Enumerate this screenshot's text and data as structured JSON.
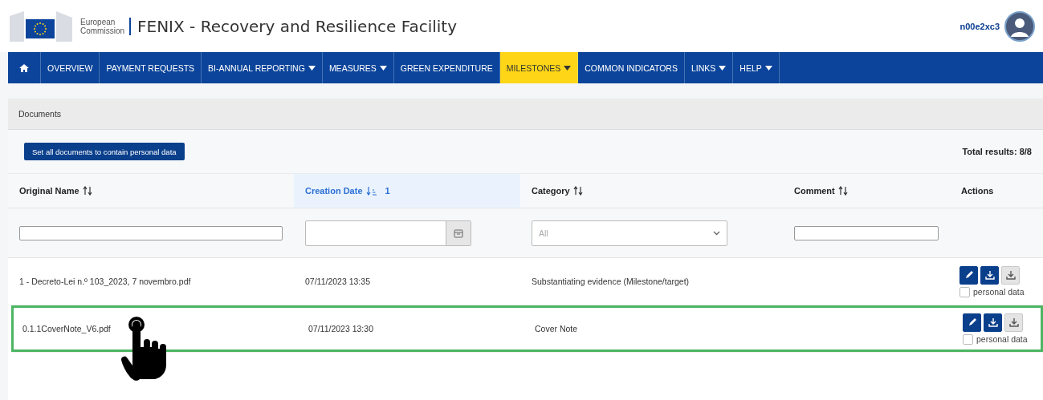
{
  "header": {
    "logo_text": [
      "European",
      "Commission"
    ],
    "title": "FENIX - Recovery and Resilience Facility",
    "username": "n00e2xc3"
  },
  "nav": [
    {
      "label": "OVERVIEW",
      "selected": false,
      "dropdown": false
    },
    {
      "label": "PAYMENT REQUESTS",
      "selected": false,
      "dropdown": false
    },
    {
      "label": "BI-ANNUAL REPORTING",
      "selected": false,
      "dropdown": true
    },
    {
      "label": "MEASURES",
      "selected": false,
      "dropdown": true
    },
    {
      "label": "GREEN EXPENDITURE",
      "selected": false,
      "dropdown": false
    },
    {
      "label": "MILESTONES",
      "selected": true,
      "dropdown": true
    },
    {
      "label": "COMMON INDICATORS",
      "selected": false,
      "dropdown": false
    },
    {
      "label": "LINKS",
      "selected": false,
      "dropdown": true
    },
    {
      "label": "HELP",
      "selected": false,
      "dropdown": true
    }
  ],
  "panel": {
    "title": "Documents",
    "button": "Set all documents to contain personal data",
    "total": "Total results: 8/8"
  },
  "table": {
    "columns": [
      {
        "label": "Original Name",
        "sortable": true,
        "sorted": false
      },
      {
        "label": "Creation Date",
        "sortable": true,
        "sorted": true,
        "sort_order": "1"
      },
      {
        "label": "Category",
        "sortable": true,
        "sorted": false
      },
      {
        "label": "Comment",
        "sortable": true,
        "sorted": false
      },
      {
        "label": "Actions",
        "sortable": false,
        "sorted": false
      }
    ],
    "filters": [
      {
        "kind": "text"
      },
      {
        "kind": "date"
      },
      {
        "kind": "select",
        "placeholder": "All"
      },
      {
        "kind": "text"
      },
      {
        "kind": "none"
      }
    ],
    "rows": [
      {
        "name": "1 - Decreto-Lei n.º 103_2023, 7 novembro.pdf",
        "date": "07/11/2023 13:35",
        "category": "Substantiating evidence (Milestone/target)",
        "personal_label": "personal data",
        "personal_data": false,
        "highlighted": false
      },
      {
        "name": "0.1.1CoverNote_V6.pdf",
        "date": "07/11/2023 13:30",
        "category": "Cover Note",
        "personal_label": "personal data",
        "personal_data": false,
        "highlighted": true
      }
    ]
  }
}
